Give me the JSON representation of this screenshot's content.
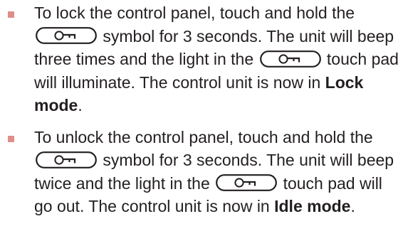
{
  "instructions": [
    {
      "parts": [
        "To lock the control panel, touch and hold the",
        "symbol for 3 seconds. The unit will beep three times and the light in the",
        "touch pad will illuminate. The control unit is now in",
        "Lock mode",
        "."
      ],
      "key_icon": "key-icon"
    },
    {
      "parts": [
        "To unlock the control panel, touch and hold the",
        "symbol for 3 seconds. The unit will beep twice and the light in the",
        "touch pad will go out. The control unit is now in",
        "Idle mode",
        "."
      ],
      "key_icon": "key-icon"
    }
  ],
  "colors": {
    "bullet": "#e08e89",
    "text": "#231f20"
  }
}
